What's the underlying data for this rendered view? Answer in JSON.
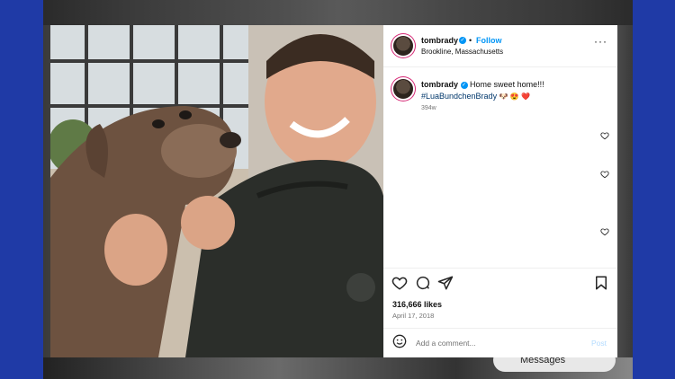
{
  "post": {
    "username": "tombrady",
    "follow_label": "Follow",
    "dot": "•",
    "location": "Brookline, Massachusetts",
    "caption_user": "tombrady",
    "caption_text": "Home sweet home!!!",
    "hashtag": "#LuaBundchenBrady",
    "emojis": "🐶 😍 ❤️",
    "age": "394w",
    "likes": "316,666 likes",
    "date": "April 17, 2018",
    "comment_placeholder": "Add a comment...",
    "post_label": "Post"
  },
  "overlay": {
    "messages_label": "Messages"
  },
  "icons": {
    "more": "more-options-icon",
    "like": "heart-icon",
    "comment": "comment-icon",
    "share": "share-icon",
    "save": "bookmark-icon",
    "emoji": "emoji-icon",
    "verified": "verified-badge-icon"
  },
  "colors": {
    "background": "#1f3aa6",
    "follow": "#0095f6",
    "hashtag": "#00376b",
    "verified": "#0095f6"
  }
}
